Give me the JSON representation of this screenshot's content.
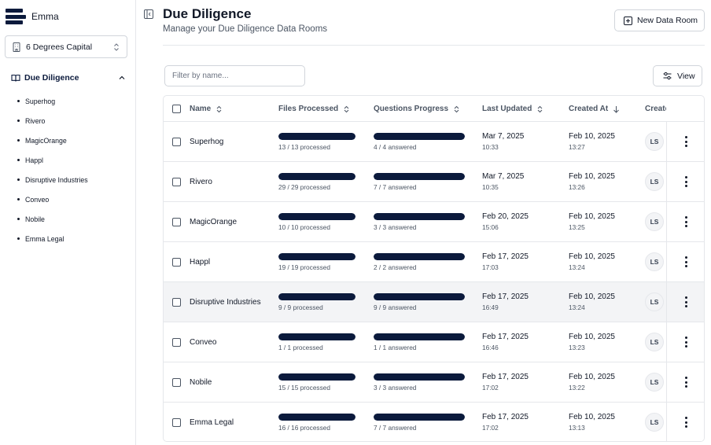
{
  "brand": {
    "name": "Emma"
  },
  "org": {
    "name": "6 Degrees Capital"
  },
  "nav": {
    "group_label": "Due Diligence",
    "items": [
      "Superhog",
      "Rivero",
      "MagicOrange",
      "Happl",
      "Disruptive Industries",
      "Conveo",
      "Nobile",
      "Emma Legal"
    ]
  },
  "header": {
    "title": "Due Diligence",
    "subtitle": "Manage your Due Diligence Data Rooms",
    "new_button": "New Data Room"
  },
  "toolbar": {
    "filter_placeholder": "Filter by name...",
    "view_label": "View"
  },
  "table": {
    "columns": {
      "name": "Name",
      "files": "Files Processed",
      "questions": "Questions Progress",
      "updated": "Last Updated",
      "created": "Created At",
      "creator": "Creator"
    },
    "rows": [
      {
        "name": "Superhog",
        "files": "13 / 13 processed",
        "files_pct": 100,
        "questions": "4 / 4 answered",
        "questions_pct": 100,
        "updated_date": "Mar 7, 2025",
        "updated_time": "10:33",
        "created_date": "Feb 10, 2025",
        "created_time": "13:27",
        "initials": "LS"
      },
      {
        "name": "Rivero",
        "files": "29 / 29 processed",
        "files_pct": 100,
        "questions": "7 / 7 answered",
        "questions_pct": 100,
        "updated_date": "Mar 7, 2025",
        "updated_time": "10:35",
        "created_date": "Feb 10, 2025",
        "created_time": "13:26",
        "initials": "LS"
      },
      {
        "name": "MagicOrange",
        "files": "10 / 10 processed",
        "files_pct": 100,
        "questions": "3 / 3 answered",
        "questions_pct": 100,
        "updated_date": "Feb 20, 2025",
        "updated_time": "15:06",
        "created_date": "Feb 10, 2025",
        "created_time": "13:25",
        "initials": "LS"
      },
      {
        "name": "Happl",
        "files": "19 / 19 processed",
        "files_pct": 100,
        "questions": "2 / 2 answered",
        "questions_pct": 100,
        "updated_date": "Feb 17, 2025",
        "updated_time": "17:03",
        "created_date": "Feb 10, 2025",
        "created_time": "13:24",
        "initials": "LS"
      },
      {
        "name": "Disruptive Industries",
        "files": "9 / 9 processed",
        "files_pct": 100,
        "questions": "9 / 9 answered",
        "questions_pct": 100,
        "updated_date": "Feb 17, 2025",
        "updated_time": "16:49",
        "created_date": "Feb 10, 2025",
        "created_time": "13:24",
        "initials": "LS"
      },
      {
        "name": "Conveo",
        "files": "1 / 1 processed",
        "files_pct": 100,
        "questions": "1 / 1 answered",
        "questions_pct": 100,
        "updated_date": "Feb 17, 2025",
        "updated_time": "16:46",
        "created_date": "Feb 10, 2025",
        "created_time": "13:23",
        "initials": "LS"
      },
      {
        "name": "Nobile",
        "files": "15 / 15 processed",
        "files_pct": 100,
        "questions": "3 / 3 answered",
        "questions_pct": 100,
        "updated_date": "Feb 17, 2025",
        "updated_time": "17:02",
        "created_date": "Feb 10, 2025",
        "created_time": "13:22",
        "initials": "LS"
      },
      {
        "name": "Emma Legal",
        "files": "16 / 16 processed",
        "files_pct": 100,
        "questions": "7 / 7 answered",
        "questions_pct": 100,
        "updated_date": "Feb 17, 2025",
        "updated_time": "17:02",
        "created_date": "Feb 10, 2025",
        "created_time": "13:13",
        "initials": "LS"
      }
    ]
  },
  "icons": {
    "logo": "stacked-bars-logo",
    "org": "building-icon",
    "org_toggle": "chevrons-up-down-icon",
    "nav_group": "book-open-icon",
    "nav_toggle": "chevron-up-icon",
    "collapse": "panel-left-icon",
    "new": "plus-square-icon",
    "view": "sliders-icon",
    "row_menu": "more-vertical-icon"
  },
  "colors": {
    "accent": "#0b1a3c",
    "border": "#e5e7eb",
    "highlight_row": "#f3f4f6"
  }
}
